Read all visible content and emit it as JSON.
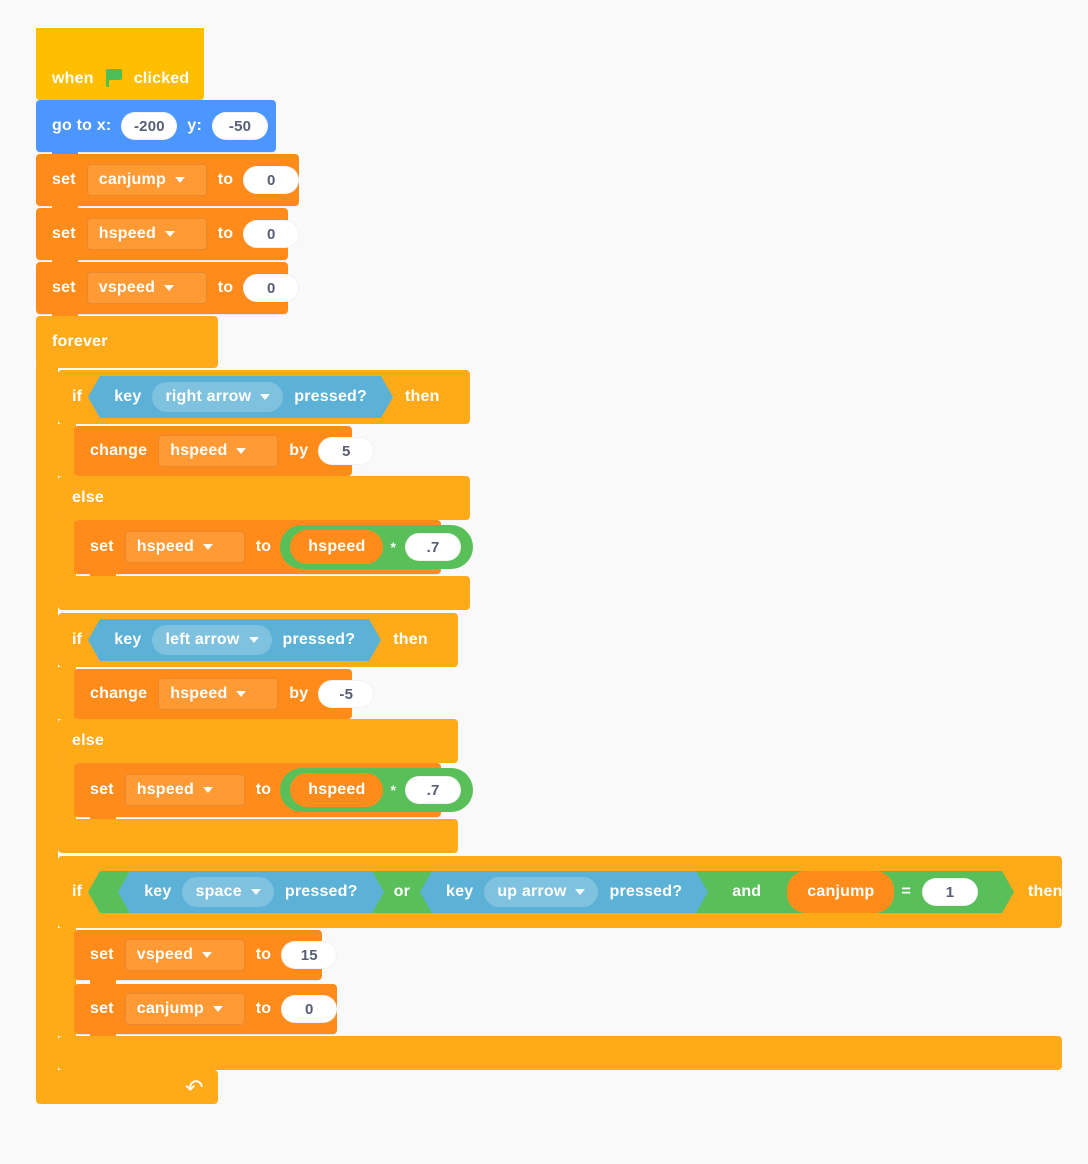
{
  "background_color": "#f9f9f9",
  "palette": {
    "events": "#FFBF00",
    "motion": "#4C97FF",
    "variables": "#FF8C1A",
    "control": "#FFAB19",
    "sensing": "#5CB1D6",
    "operators": "#59C059",
    "input_text": "#575E75"
  },
  "script": {
    "hat": {
      "when_label": "when",
      "flag_icon": "green-flag-icon",
      "clicked_label": "clicked"
    },
    "goto": {
      "label_x": "go to x:",
      "value_x": "-200",
      "label_y": "y:",
      "value_y": "-50"
    },
    "set_canjump_init": {
      "set_label": "set",
      "variable": "canjump",
      "to_label": "to",
      "value": "0"
    },
    "set_hspeed_init": {
      "set_label": "set",
      "variable": "hspeed",
      "to_label": "to",
      "value": "0"
    },
    "set_vspeed_init": {
      "set_label": "set",
      "variable": "vspeed",
      "to_label": "to",
      "value": "0"
    },
    "forever": {
      "label": "forever",
      "loop_icon": "loop-arrow-icon"
    },
    "if_right": {
      "if_label": "if",
      "then_label": "then",
      "else_label": "else",
      "condition": {
        "key_label": "key",
        "key_option": "right arrow",
        "pressed_label": "pressed?"
      },
      "body": {
        "change_label": "change",
        "variable": "hspeed",
        "by_label": "by",
        "value": "5"
      },
      "else_body": {
        "set_label": "set",
        "variable": "hspeed",
        "to_label": "to",
        "operand_left": "hspeed",
        "operator": "*",
        "operand_right": ".7"
      }
    },
    "if_left": {
      "if_label": "if",
      "then_label": "then",
      "else_label": "else",
      "condition": {
        "key_label": "key",
        "key_option": "left arrow",
        "pressed_label": "pressed?"
      },
      "body": {
        "change_label": "change",
        "variable": "hspeed",
        "by_label": "by",
        "value": "-5"
      },
      "else_body": {
        "set_label": "set",
        "variable": "hspeed",
        "to_label": "to",
        "operand_left": "hspeed",
        "operator": "*",
        "operand_right": ".7"
      }
    },
    "if_jump": {
      "if_label": "if",
      "then_label": "then",
      "condition": {
        "key_label_1": "key",
        "key_option_1": "space",
        "pressed_label_1": "pressed?",
        "or_label": "or",
        "key_label_2": "key",
        "key_option_2": "up arrow",
        "pressed_label_2": "pressed?",
        "and_label": "and",
        "compare_left": "canjump",
        "compare_operator": "=",
        "compare_right": "1"
      },
      "body": [
        {
          "set_label": "set",
          "variable": "vspeed",
          "to_label": "to",
          "value": "15"
        },
        {
          "set_label": "set",
          "variable": "canjump",
          "to_label": "to",
          "value": "0"
        }
      ]
    }
  }
}
